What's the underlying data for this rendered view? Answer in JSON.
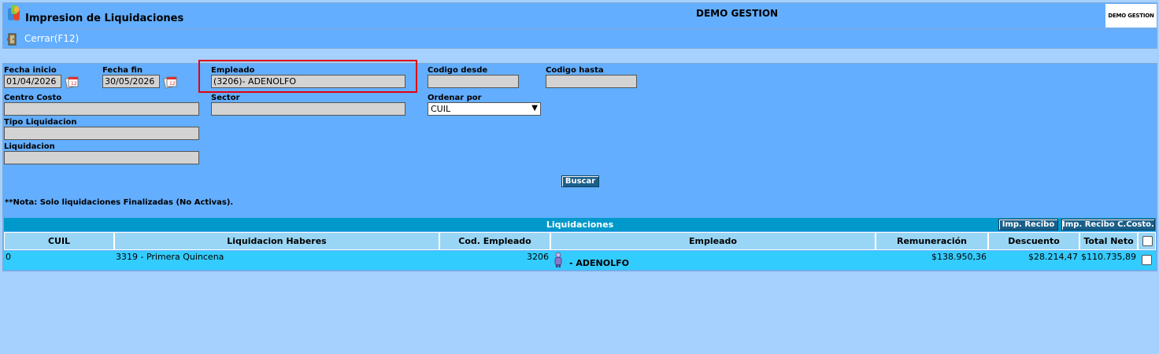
{
  "header": {
    "title": "Impresion de Liquidaciones",
    "company": "DEMO GESTION",
    "logo_text": "DEMO GESTION"
  },
  "toolbar": {
    "close_label": "Cerrar(F12)"
  },
  "form": {
    "fecha_inicio": {
      "label": "Fecha inicio",
      "value": "01/04/2026"
    },
    "fecha_fin": {
      "label": "Fecha fin",
      "value": "30/05/2026"
    },
    "empleado": {
      "label": "Empleado",
      "value": "(3206)- ADENOLFO"
    },
    "codigo_desde": {
      "label": "Codigo desde",
      "value": ""
    },
    "codigo_hasta": {
      "label": "Codigo hasta",
      "value": ""
    },
    "centro_costo": {
      "label": "Centro Costo",
      "value": ""
    },
    "sector": {
      "label": "Sector",
      "value": ""
    },
    "ordenar_por": {
      "label": "Ordenar por",
      "value": "CUIL"
    },
    "tipo_liquidacion": {
      "label": "Tipo Liquidacion",
      "value": ""
    },
    "liquidacion": {
      "label": "Liquidacion",
      "value": ""
    },
    "search_label": "Buscar",
    "note": "**Nota: Solo liquidaciones Finalizadas (No Activas)."
  },
  "grid": {
    "title": "Liquidaciones",
    "imp_recibo_label": "Imp. Recibo",
    "imp_recibo_ccosto_label": "Imp. Recibo C.Costo.",
    "columns": [
      "CUIL",
      "Liquidacion Haberes",
      "Cod. Empleado",
      "Empleado",
      "Remuneración",
      "Descuento",
      "Total Neto"
    ],
    "rows": [
      {
        "cuil": "0",
        "liquidacion": "3319 - Primera Quincena",
        "cod_empleado": "3206",
        "empleado": "- ADENOLFO",
        "remuneracion": "$138.950,36",
        "descuento": "$28.214,47",
        "total_neto": "$110.735,89"
      }
    ]
  }
}
